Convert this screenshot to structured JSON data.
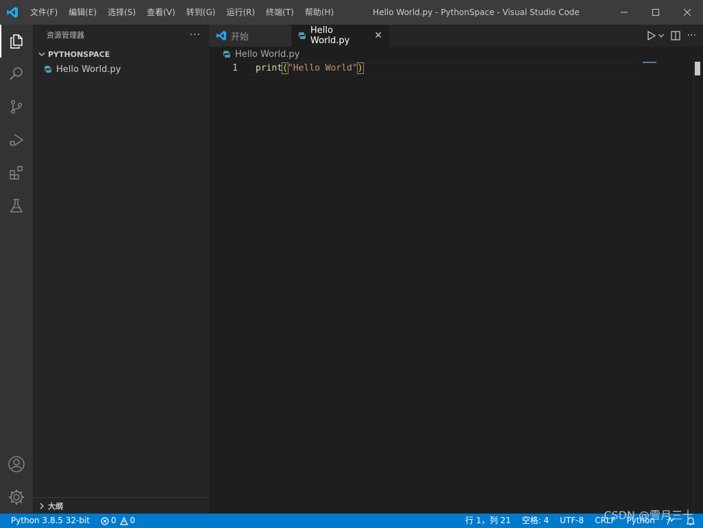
{
  "titlebar": {
    "menus": [
      "文件(F)",
      "编辑(E)",
      "选择(S)",
      "查看(V)",
      "转到(G)",
      "运行(R)",
      "终端(T)",
      "帮助(H)"
    ],
    "title": "Hello World.py - PythonSpace - Visual Studio Code"
  },
  "activitybar": {
    "items": [
      "explorer-icon",
      "search-icon",
      "source-control-icon",
      "run-debug-icon",
      "extensions-icon",
      "testing-icon"
    ],
    "bottom": [
      "account-icon",
      "settings-gear-icon"
    ]
  },
  "sidebar": {
    "title": "资源管理器",
    "more": "···",
    "folder": "PYTHONSPACE",
    "file": "Hello World.py",
    "outline": "大纲"
  },
  "tabs": {
    "start": "开始",
    "active": "Hello World.py",
    "close": "✕"
  },
  "breadcrumb": {
    "file": "Hello World.py"
  },
  "editor": {
    "line_number": "1",
    "code": {
      "fn": "print",
      "open": "(",
      "str": "\"Hello World\"",
      "close": ")"
    }
  },
  "statusbar": {
    "interpreter": "Python 3.8.5 32-bit",
    "errors": "0",
    "warnings": "0",
    "position": "行 1，列 21",
    "spaces": "空格: 4",
    "encoding": "UTF-8",
    "eol": "CRLF",
    "language": "Python"
  },
  "watermark": "CSDN @雪月三十",
  "colors": {
    "accent": "#007acc",
    "titlebar": "#3c3c3c",
    "sidebar": "#252526",
    "editor": "#1e1e1e",
    "python_icon": "#519aba"
  }
}
